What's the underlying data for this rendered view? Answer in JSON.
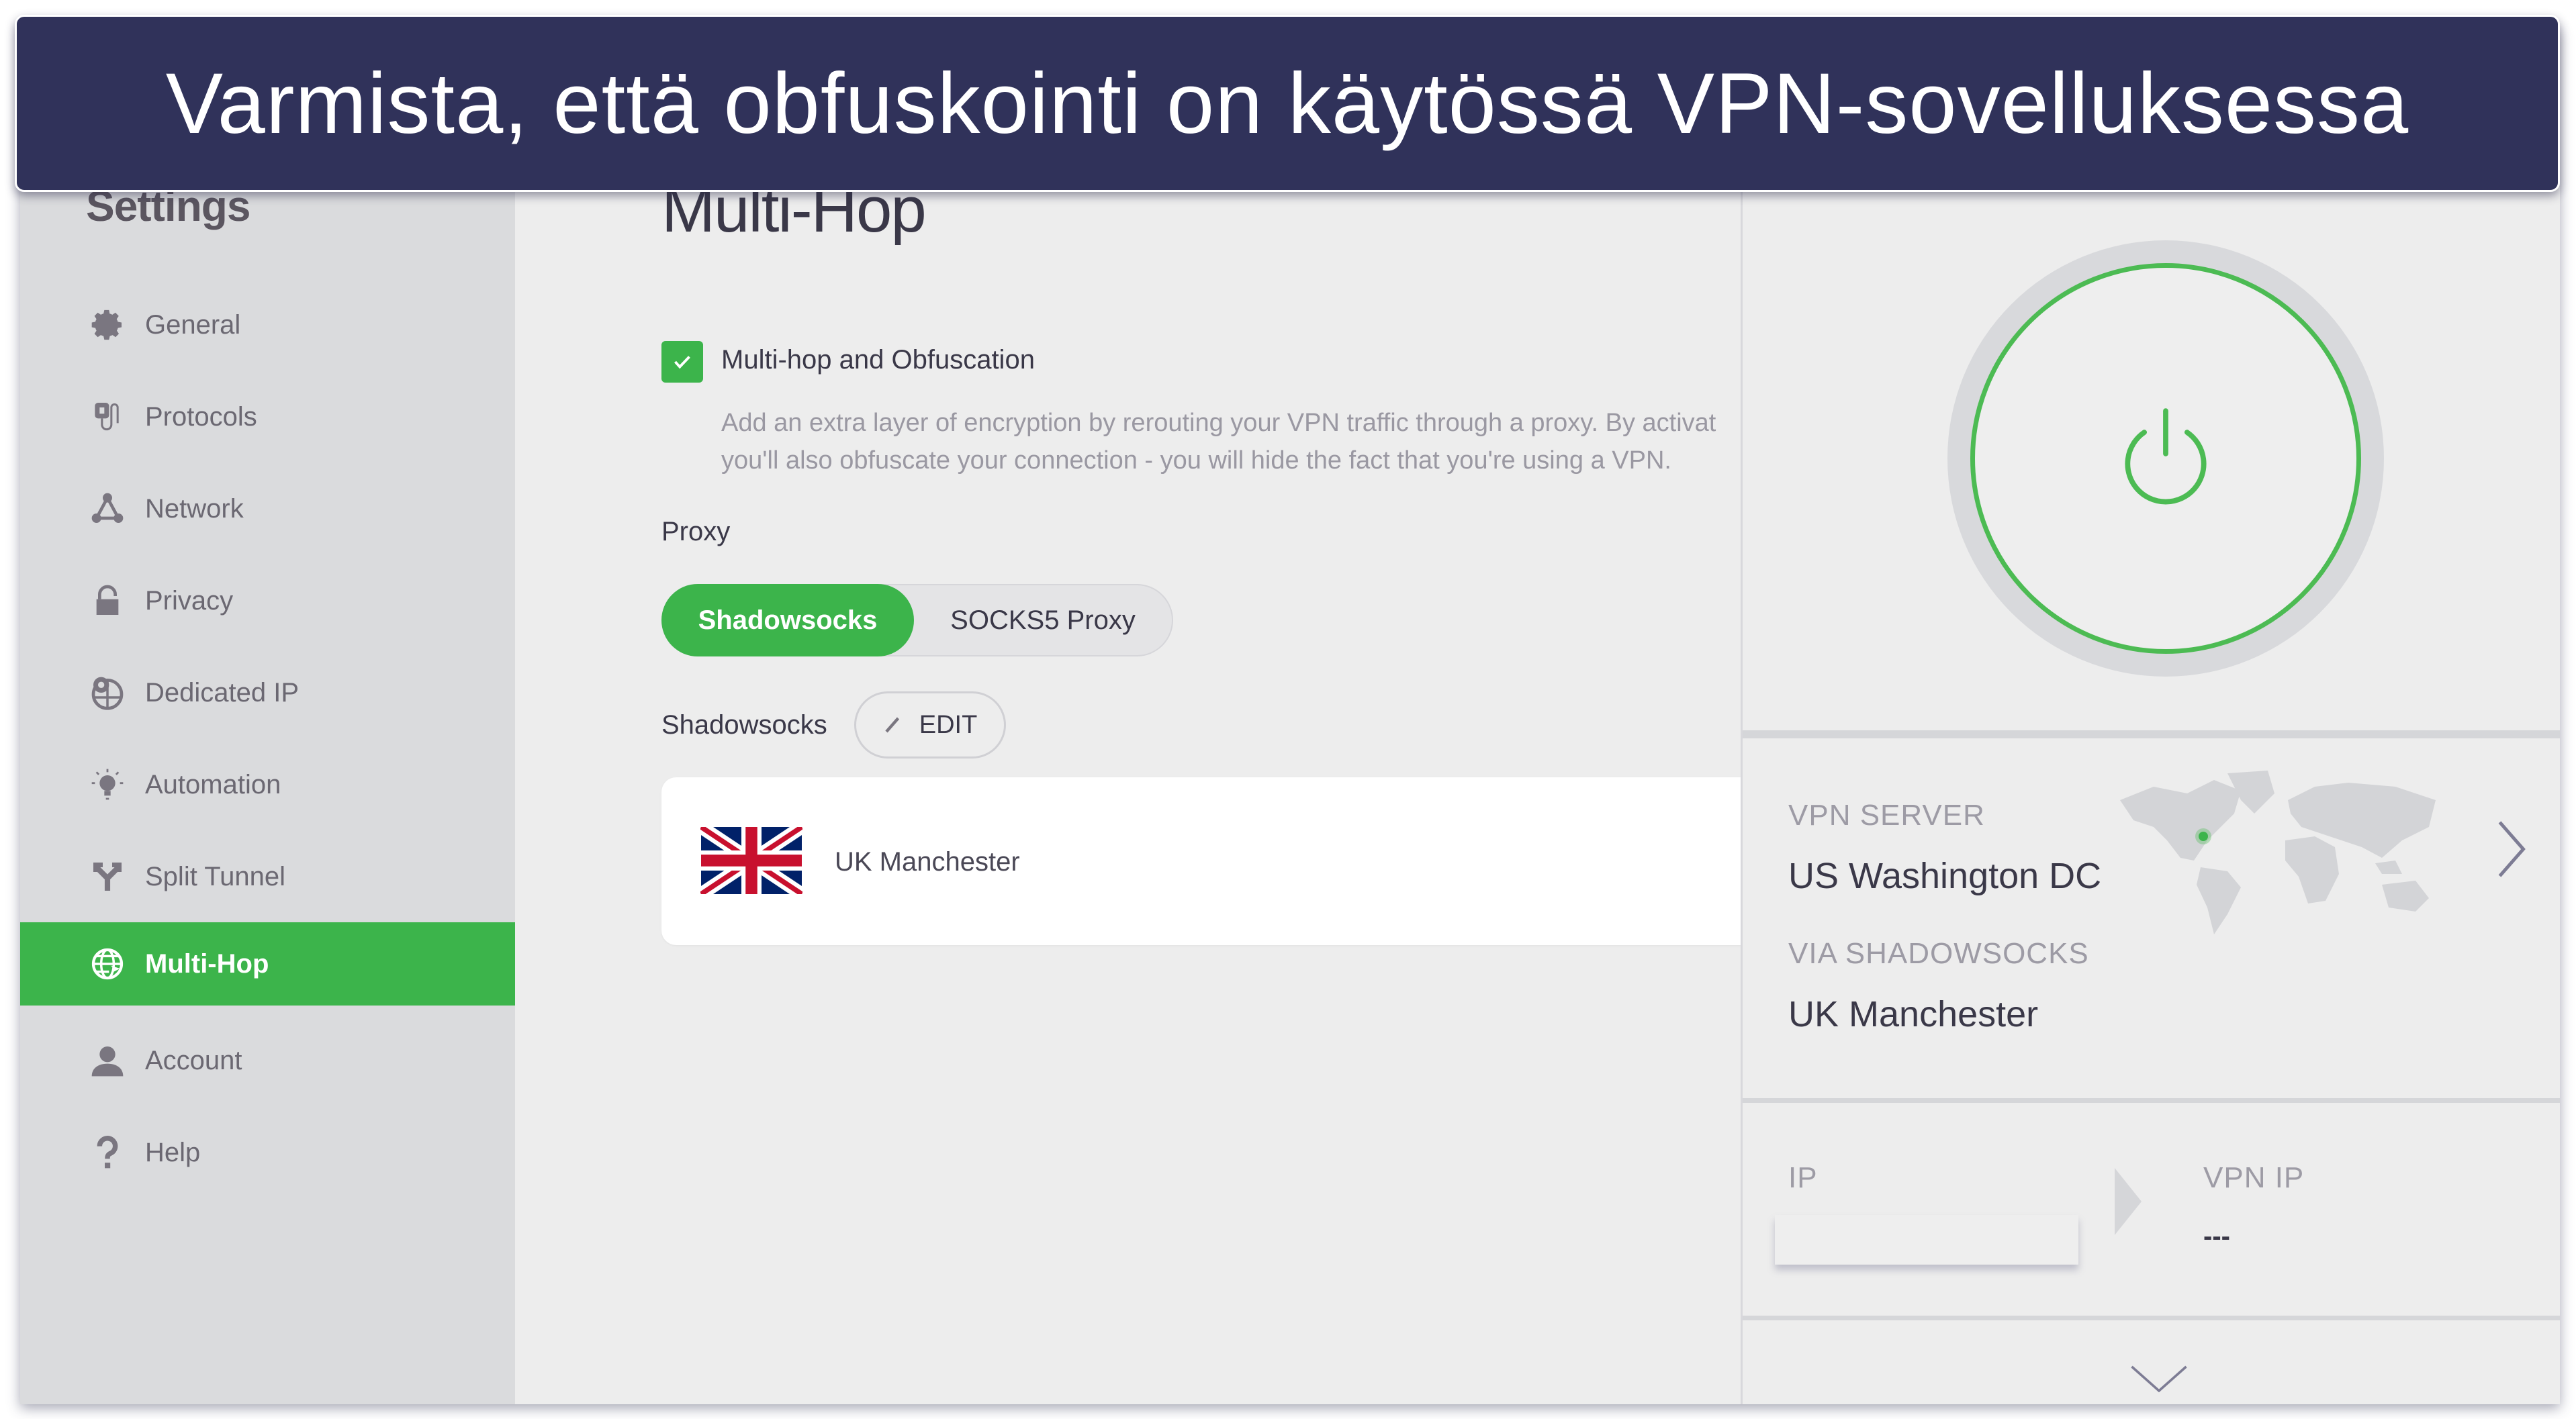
{
  "banner": {
    "text": "Varmista, että obfuskointi on käytössä VPN-sovelluksessa",
    "bg_color": "#30325a"
  },
  "sidebar": {
    "title": "Settings",
    "items": [
      {
        "label": "General",
        "icon": "gear-icon",
        "active": false
      },
      {
        "label": "Protocols",
        "icon": "plug-icon",
        "active": false
      },
      {
        "label": "Network",
        "icon": "network-icon",
        "active": false
      },
      {
        "label": "Privacy",
        "icon": "lock-icon",
        "active": false
      },
      {
        "label": "Dedicated IP",
        "icon": "globe-pin-icon",
        "active": false
      },
      {
        "label": "Automation",
        "icon": "lightbulb-icon",
        "active": false
      },
      {
        "label": "Split Tunnel",
        "icon": "split-arrow-icon",
        "active": false
      },
      {
        "label": "Multi-Hop",
        "icon": "globe-arrow-icon",
        "active": true
      },
      {
        "label": "Account",
        "icon": "user-icon",
        "active": false
      },
      {
        "label": "Help",
        "icon": "question-icon",
        "active": false
      }
    ],
    "active_color": "#3cb44b"
  },
  "main": {
    "title": "Multi-Hop",
    "checkbox": {
      "label": "Multi-hop and Obfuscation",
      "checked": true
    },
    "description": {
      "line1": "Add an extra layer of encryption by rerouting your VPN traffic through a proxy. By activat",
      "line2": "you'll also obfuscate your connection - you will hide the fact that you're using a VPN."
    },
    "proxy_label": "Proxy",
    "proxy_options": [
      {
        "label": "Shadowsocks",
        "selected": true
      },
      {
        "label": "SOCKS5 Proxy",
        "selected": false
      }
    ],
    "shadowsocks_label": "Shadowsocks",
    "edit_label": "EDIT",
    "server": {
      "label": "UK Manchester",
      "flag": "uk-flag"
    }
  },
  "status_panel": {
    "connected": true,
    "vpn_server_label": "VPN SERVER",
    "vpn_server_value": "US Washington DC",
    "via_label": "VIA SHADOWSOCKS",
    "via_value": "UK Manchester",
    "ip_label": "IP",
    "ip_value": "",
    "vpn_ip_label": "VPN IP",
    "vpn_ip_value": "---",
    "accent_color": "#4cbb53"
  }
}
